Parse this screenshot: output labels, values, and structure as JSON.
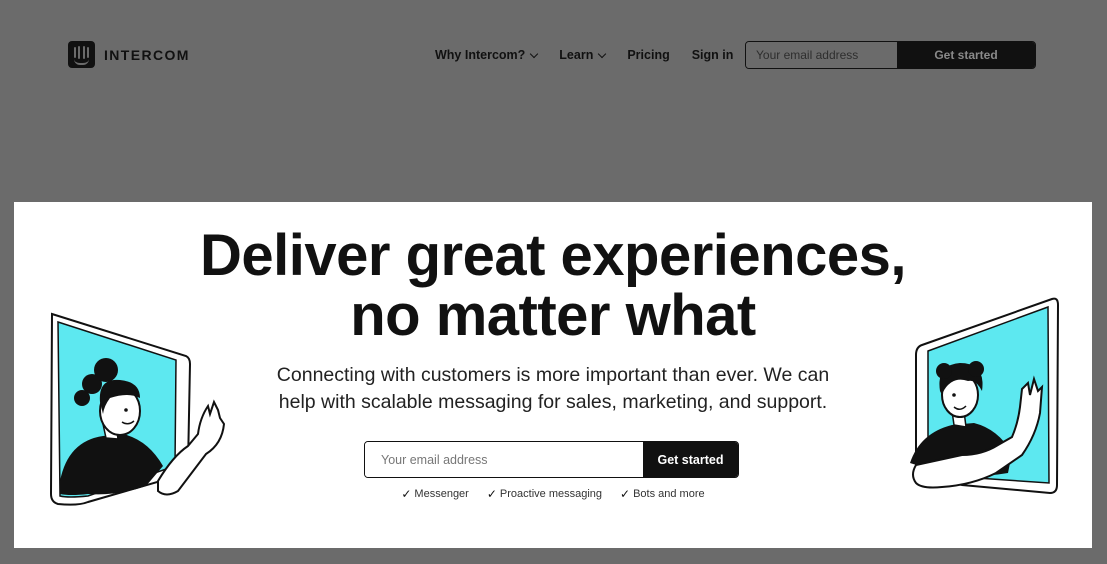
{
  "nav": {
    "logo_text": "INTERCOM",
    "links": [
      {
        "label": "Why Intercom?",
        "has_dropdown": true
      },
      {
        "label": "Learn",
        "has_dropdown": true
      },
      {
        "label": "Pricing",
        "has_dropdown": false
      },
      {
        "label": "Sign in",
        "has_dropdown": false
      }
    ],
    "email_placeholder": "Your email address",
    "cta_label": "Get started"
  },
  "hero": {
    "headline_line1": "Deliver great experiences,",
    "headline_line2": "no matter what",
    "subtext_line1": "Connecting with customers is more important than ever. We can",
    "subtext_line2": "help with scalable messaging for sales, marketing, and support.",
    "email_placeholder": "Your email address",
    "cta_label": "Get started",
    "features": [
      "Messenger",
      "Proactive messaging",
      "Bots and more"
    ]
  },
  "colors": {
    "overlay": "#6b6b6b",
    "text": "#111111",
    "illustration_window": "#5de8f0",
    "hero_bg": "#ffffff"
  },
  "icons": {
    "logo": "intercom-logo-icon",
    "dropdown": "chevron-down-icon",
    "feature_check": "check-icon"
  }
}
